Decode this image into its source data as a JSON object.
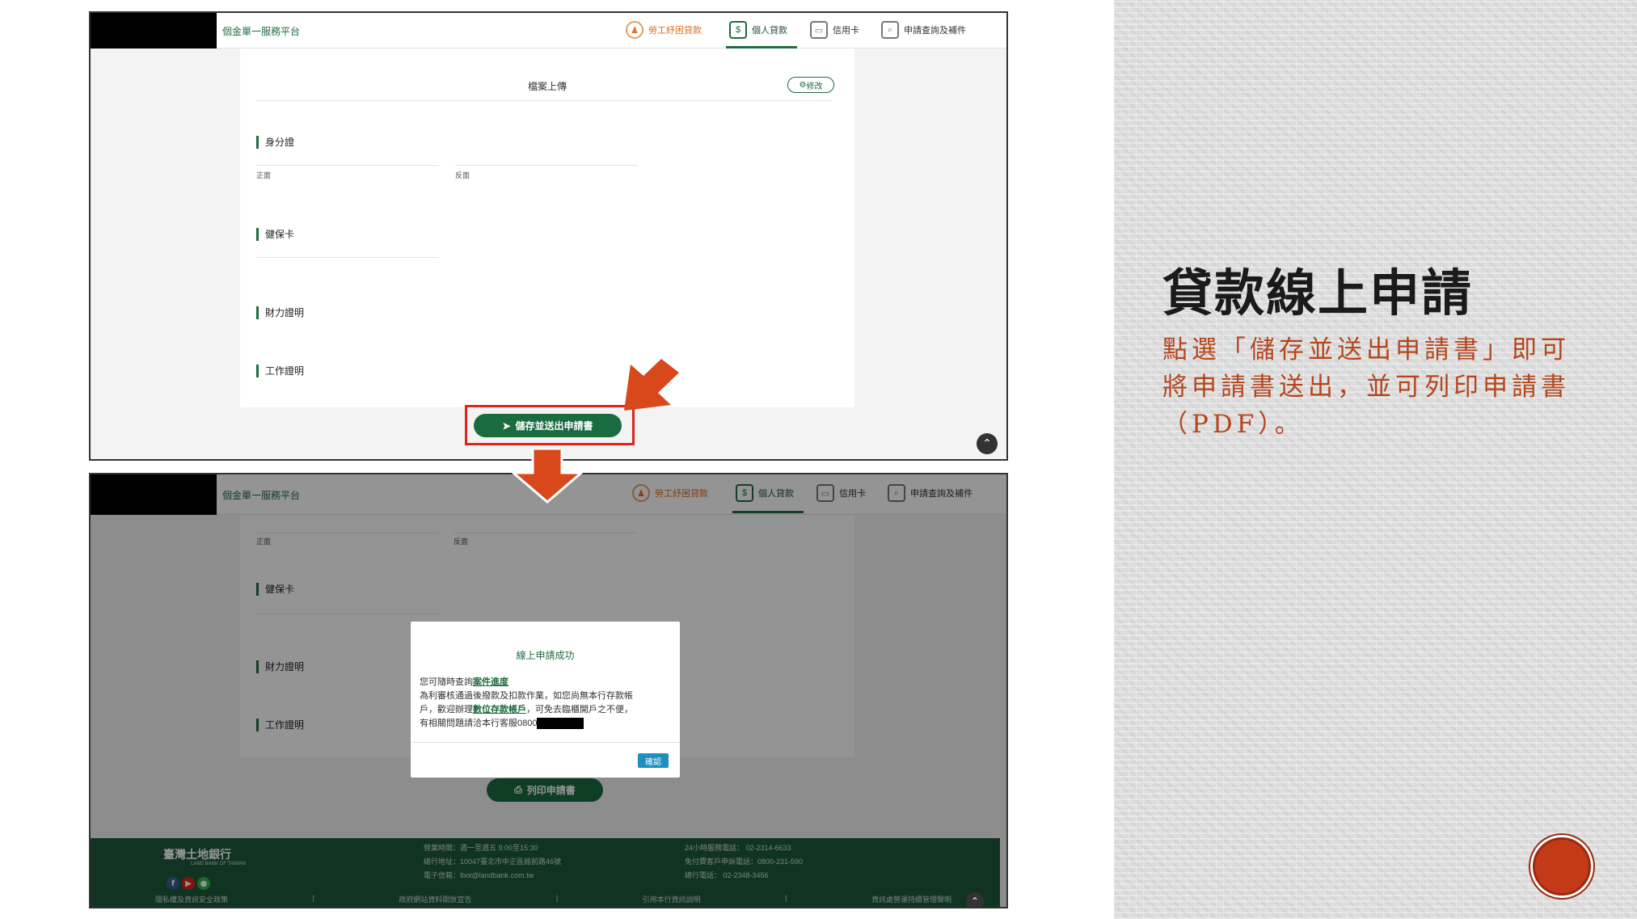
{
  "slide": {
    "title": "貸款線上申請",
    "description": "點選「儲存並送出申請書」即可將申請書送出，並可列印申請書（PDF）。"
  },
  "platform": {
    "brand": "個金單一服務平台",
    "nav": [
      {
        "label": "勞工紓困貸款",
        "icon": "worker-icon"
      },
      {
        "label": "個人貸款",
        "icon": "money-icon"
      },
      {
        "label": "信用卡",
        "icon": "credit-card-icon"
      },
      {
        "label": "申請查詢及補件",
        "icon": "search-doc-icon"
      }
    ]
  },
  "screen1": {
    "card_title": "檔案上傳",
    "edit_label": "修改",
    "id_section": "身分證",
    "front_label": "正面",
    "back_label": "反面",
    "health_section": "健保卡",
    "finance_section": "財力證明",
    "work_section": "工作證明",
    "submit_label": "儲存並送出申請書"
  },
  "screen2": {
    "front_label": "正面",
    "back_label": "反面",
    "health_section": "健保卡",
    "finance_section": "財力證明",
    "work_section": "工作證明",
    "print_label": "列印申請書",
    "modal": {
      "title": "線上申請成功",
      "line1_prefix": "您可隨時查詢",
      "line1_link": "案件進度",
      "line2": "為利審核通過後撥款及扣款作業，如您尚無本行存款帳",
      "line3_prefix": "戶，歡迎辦理",
      "line3_link": "數位存款帳戶",
      "line3_suffix": "，可免去臨櫃開戶之不便，",
      "line4_prefix": "有相關問題請洽本行客服0800",
      "ok_label": "確認"
    },
    "footer": {
      "logo_text": "臺灣土地銀行",
      "logo_sub": "LAND BANK OF TAIWAN",
      "col1": [
        "營業時間：週一至週五 9:00至15:30",
        "總行地址：10047臺北市中正區館前路46號",
        "電子信箱：lbot@landbank.com.tw"
      ],
      "col2": [
        "24小時服務電話： 02-2314-6633",
        "免付費客戶申訴電話：0800-231-590",
        "總行電話： 02-2348-3456"
      ],
      "links": [
        "隱私權及資訊安全政策",
        "政府網站資料開放宣告",
        "引用本行資訊說明",
        "資訊處營運持續管理聲明"
      ]
    }
  },
  "colors": {
    "brand_green": "#1f6b3f",
    "accent_orange": "#e0701c",
    "highlight_red": "#e0241a",
    "title_text": "#1a1a1a",
    "desc_text": "#b5451b"
  }
}
